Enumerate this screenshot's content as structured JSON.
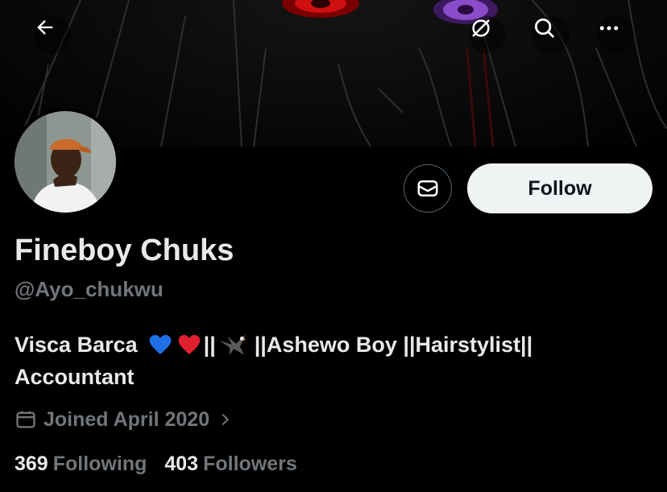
{
  "banner": {
    "description_icons": [
      "back-arrow-icon",
      "translate-off-icon",
      "search-icon",
      "more-icon"
    ]
  },
  "profile": {
    "display_name": "Fineboy Chuks",
    "handle": "@Ayo_chukwu",
    "bio_line1_prefix": "Visca Barca",
    "bio_line1_sep1": "||",
    "bio_line1_suffix": "||Ashewo Boy ||Hairstylist||",
    "bio_line2": "Accountant",
    "joined": "Joined April 2020"
  },
  "actions": {
    "follow_label": "Follow"
  },
  "stats": {
    "following_count": "369",
    "following_label": "Following",
    "followers_count": "403",
    "followers_label": "Followers"
  },
  "colors": {
    "background": "#000000",
    "text_primary": "#e7e9ea",
    "text_secondary": "#71767b",
    "follow_bg": "#eff3f4",
    "border": "#536471"
  }
}
